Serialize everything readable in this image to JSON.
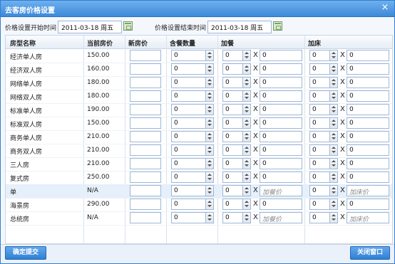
{
  "window": {
    "title": "去客房价格设置",
    "close_glyph": "×"
  },
  "dates": {
    "start_label": "价格设置开始时间",
    "start_value": "2011-03-18 周五",
    "end_label": "价格设置结束时间",
    "end_value": "2011-03-18 周五"
  },
  "table": {
    "headers": [
      "房型名称",
      "当前房价",
      "新房价",
      "含餐数量",
      "加餐",
      "加床"
    ],
    "times_symbol": "X",
    "rows": [
      {
        "name": "经济单人房",
        "price": "150.00",
        "meals": "0",
        "extra_meal_qty": "0",
        "extra_meal_price": "0",
        "meal_placeholder": "",
        "extra_bed_qty": "0",
        "extra_bed_price": "0",
        "bed_placeholder": ""
      },
      {
        "name": "经济双人房",
        "price": "160.00",
        "meals": "0",
        "extra_meal_qty": "0",
        "extra_meal_price": "0",
        "meal_placeholder": "",
        "extra_bed_qty": "0",
        "extra_bed_price": "0",
        "bed_placeholder": ""
      },
      {
        "name": "网络单人房",
        "price": "180.00",
        "meals": "0",
        "extra_meal_qty": "0",
        "extra_meal_price": "0",
        "meal_placeholder": "",
        "extra_bed_qty": "0",
        "extra_bed_price": "0",
        "bed_placeholder": ""
      },
      {
        "name": "网络双人房",
        "price": "180.00",
        "meals": "0",
        "extra_meal_qty": "0",
        "extra_meal_price": "0",
        "meal_placeholder": "",
        "extra_bed_qty": "0",
        "extra_bed_price": "0",
        "bed_placeholder": ""
      },
      {
        "name": "标准单人房",
        "price": "190.00",
        "meals": "0",
        "extra_meal_qty": "0",
        "extra_meal_price": "0",
        "meal_placeholder": "",
        "extra_bed_qty": "0",
        "extra_bed_price": "0",
        "bed_placeholder": ""
      },
      {
        "name": "标准双人房",
        "price": "150.00",
        "meals": "0",
        "extra_meal_qty": "0",
        "extra_meal_price": "0",
        "meal_placeholder": "",
        "extra_bed_qty": "0",
        "extra_bed_price": "0",
        "bed_placeholder": ""
      },
      {
        "name": "商务单人房",
        "price": "210.00",
        "meals": "0",
        "extra_meal_qty": "0",
        "extra_meal_price": "0",
        "meal_placeholder": "",
        "extra_bed_qty": "0",
        "extra_bed_price": "0",
        "bed_placeholder": ""
      },
      {
        "name": "商务双人房",
        "price": "210.00",
        "meals": "0",
        "extra_meal_qty": "0",
        "extra_meal_price": "0",
        "meal_placeholder": "",
        "extra_bed_qty": "0",
        "extra_bed_price": "0",
        "bed_placeholder": ""
      },
      {
        "name": "三人房",
        "price": "210.00",
        "meals": "0",
        "extra_meal_qty": "0",
        "extra_meal_price": "0",
        "meal_placeholder": "",
        "extra_bed_qty": "0",
        "extra_bed_price": "0",
        "bed_placeholder": ""
      },
      {
        "name": "复式房",
        "price": "250.00",
        "meals": "0",
        "extra_meal_qty": "0",
        "extra_meal_price": "0",
        "meal_placeholder": "",
        "extra_bed_qty": "0",
        "extra_bed_price": "0",
        "bed_placeholder": ""
      },
      {
        "name": "单",
        "price": "N/A",
        "meals": "0",
        "extra_meal_qty": "0",
        "extra_meal_price": "",
        "meal_placeholder": "加餐价",
        "extra_bed_qty": "0",
        "extra_bed_price": "",
        "bed_placeholder": "加床价",
        "highlight": true
      },
      {
        "name": "海景房",
        "price": "290.00",
        "meals": "0",
        "extra_meal_qty": "0",
        "extra_meal_price": "0",
        "meal_placeholder": "",
        "extra_bed_qty": "0",
        "extra_bed_price": "0",
        "bed_placeholder": ""
      },
      {
        "name": "总统房",
        "price": "N/A",
        "meals": "0",
        "extra_meal_qty": "0",
        "extra_meal_price": "",
        "meal_placeholder": "加餐价",
        "extra_bed_qty": "0",
        "extra_bed_price": "",
        "bed_placeholder": "加床价"
      }
    ]
  },
  "footer": {
    "submit_label": "确定提交",
    "close_label": "关闭窗口"
  },
  "colors": {
    "title_bar": "#3d8ad9",
    "button": "#2f7fd3",
    "highlight_row": "#e5f0fb"
  }
}
